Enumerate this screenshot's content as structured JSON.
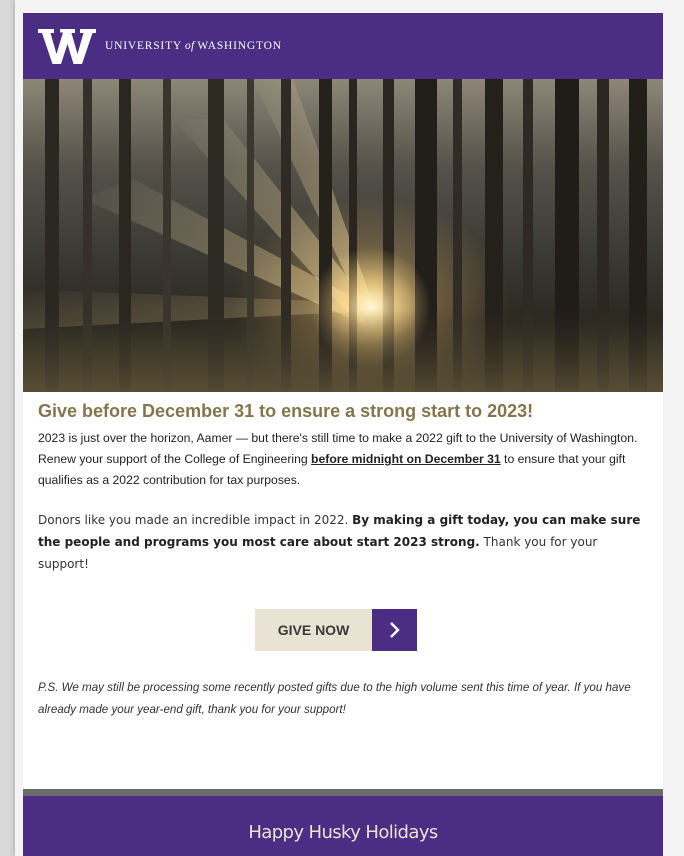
{
  "header": {
    "logo_letter": "W",
    "wordmark_pre": "UNIVERSITY",
    "wordmark_of": "of",
    "wordmark_post": "WASHINGTON"
  },
  "hero": {
    "icon": "forest-sunlight-photo"
  },
  "headline": "Give before December 31 to ensure a strong start to 2023!",
  "paragraph1": {
    "text_a": "2023 is just over the horizon, Aamer — but there's still time to make a 2022 gift to the University of Washington. Renew your support of the College of Engineering ",
    "link": "before midnight on December 31",
    "text_b": " to ensure that your gift qualifies as a 2022 contribution for tax purposes."
  },
  "paragraph2": {
    "text_a": "Donors like you made an incredible impact in 2022. ",
    "bold": "By making a gift today, you can make sure the people and programs you most care about start 2023 strong.",
    "text_b": " Thank you for your support!"
  },
  "cta": {
    "label": "GIVE NOW",
    "icon": "chevron-right-icon"
  },
  "ps": "P.S. We may still be processing some recently posted gifts due to the high volume sent this time of year. If you have already made your year-end gift, thank you for your support!",
  "footer": {
    "text": "Happy Husky Holidays"
  },
  "colors": {
    "brand_purple": "#4b2e83",
    "brand_gold": "#85754d",
    "cta_bg": "#e8e3d3",
    "divider": "#6b6b6b"
  }
}
